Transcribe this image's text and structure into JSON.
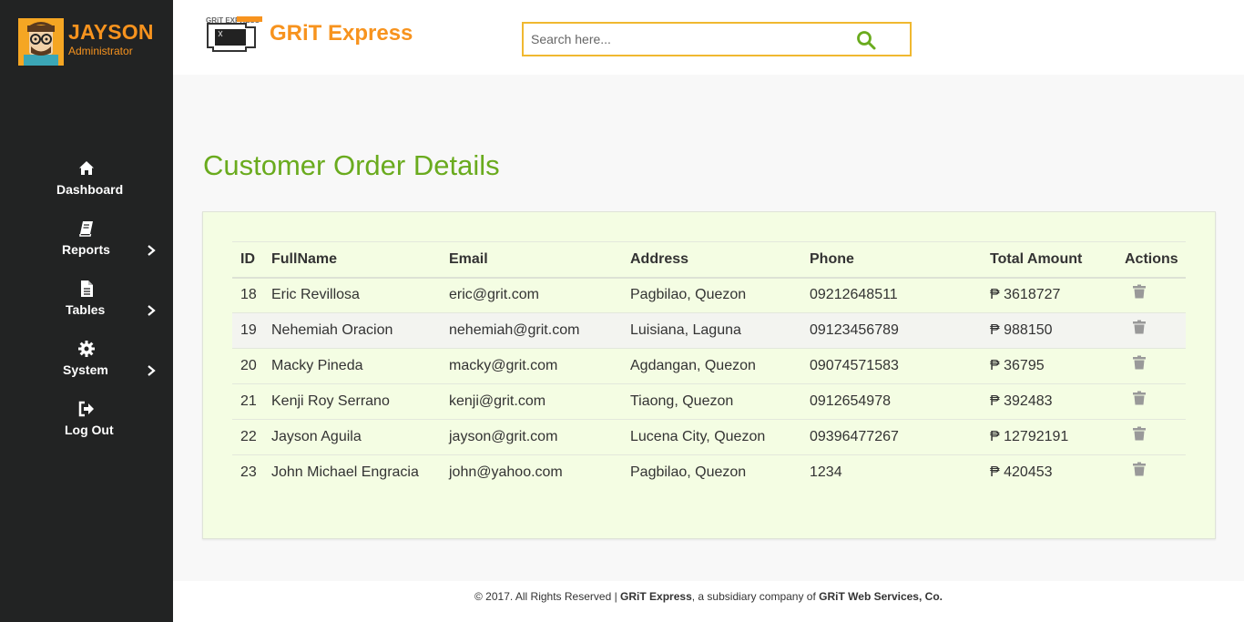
{
  "profile": {
    "name": "JAYSON",
    "role": "Administrator"
  },
  "nav": {
    "items": [
      {
        "label": "Dashboard",
        "icon": "home-icon",
        "has_submenu": false
      },
      {
        "label": "Reports",
        "icon": "book-icon",
        "has_submenu": true
      },
      {
        "label": "Tables",
        "icon": "file-icon",
        "has_submenu": true
      },
      {
        "label": "System",
        "icon": "gear-icon",
        "has_submenu": true
      },
      {
        "label": "Log Out",
        "icon": "sign-out-icon",
        "has_submenu": false
      }
    ]
  },
  "header": {
    "logo_text": "GRiT EXPRESS",
    "brand": "GRiT Express",
    "search_placeholder": "Search here..."
  },
  "page": {
    "title": "Customer Order Details"
  },
  "table": {
    "headers": [
      "ID",
      "FullName",
      "Email",
      "Address",
      "Phone",
      "Total Amount",
      "Actions"
    ],
    "rows": [
      {
        "id": "18",
        "name": "Eric Revillosa",
        "email": "eric@grit.com",
        "address": "Pagbilao, Quezon",
        "phone": "09212648511",
        "amount": "₱ 3618727"
      },
      {
        "id": "19",
        "name": "Nehemiah Oracion",
        "email": "nehemiah@grit.com",
        "address": "Luisiana, Laguna",
        "phone": "09123456789",
        "amount": "₱ 988150"
      },
      {
        "id": "20",
        "name": "Macky Pineda",
        "email": "macky@grit.com",
        "address": "Agdangan, Quezon",
        "phone": "09074571583",
        "amount": "₱ 36795"
      },
      {
        "id": "21",
        "name": "Kenji Roy Serrano",
        "email": "kenji@grit.com",
        "address": "Tiaong, Quezon",
        "phone": "0912654978",
        "amount": "₱ 392483"
      },
      {
        "id": "22",
        "name": "Jayson Aguila",
        "email": "jayson@grit.com",
        "address": "Lucena City, Quezon",
        "phone": "09396477267",
        "amount": "₱ 12792191"
      },
      {
        "id": "23",
        "name": "John Michael Engracia",
        "email": "john@yahoo.com",
        "address": "Pagbilao, Quezon",
        "phone": "1234",
        "amount": "₱ 420453"
      }
    ],
    "row_action_icon": "trash-icon"
  },
  "footer": {
    "prefix": "© 2017. All Rights Reserved | ",
    "company": "GRiT Express",
    "middle": ", a subsidiary company of ",
    "parent": "GRiT Web Services, Co."
  },
  "colors": {
    "sidebar_bg": "#222323",
    "accent_orange": "#f7931e",
    "title_green": "#6aab1e",
    "panel_bg": "#f4fde3",
    "search_border": "#f0b830"
  }
}
